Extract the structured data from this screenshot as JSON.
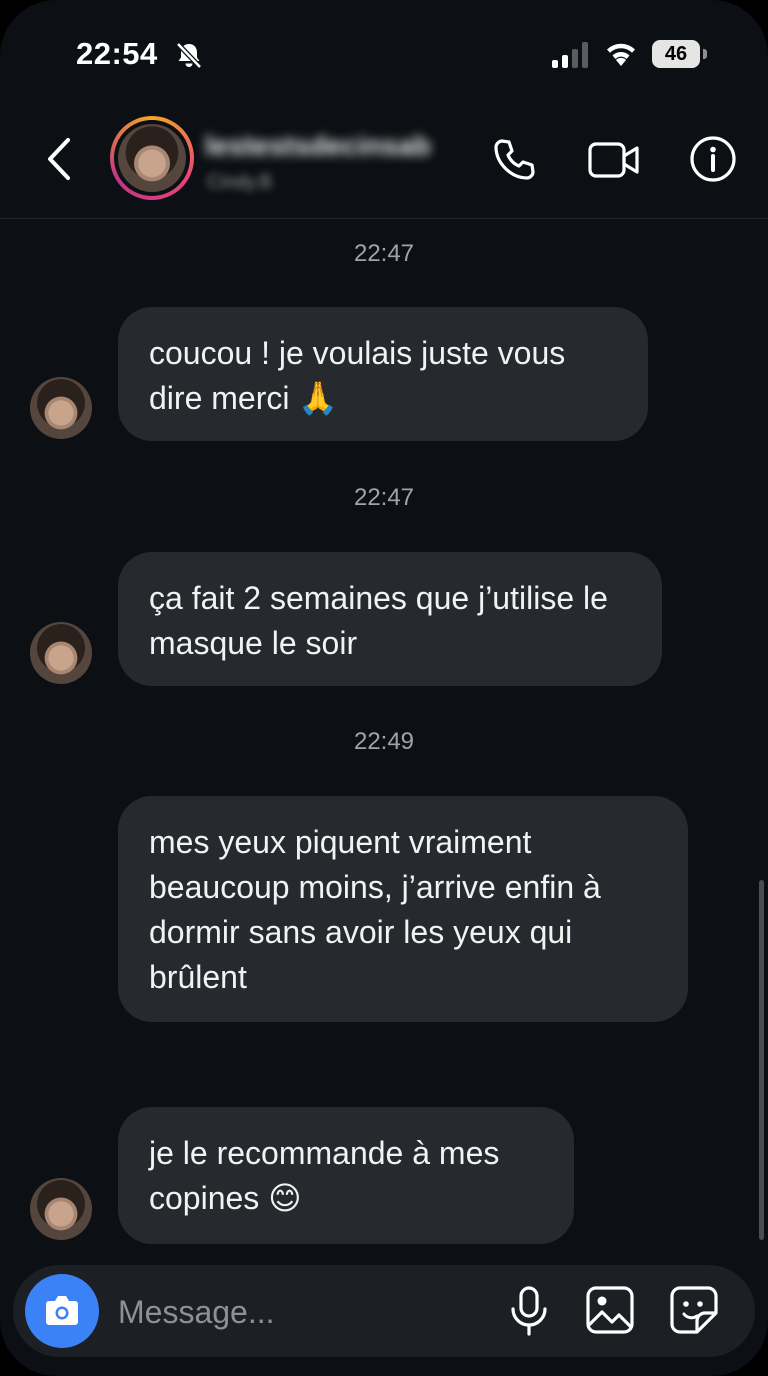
{
  "status_bar": {
    "time": "22:54",
    "battery": "46"
  },
  "header": {
    "username": "lestestsdecinsab",
    "subtitle": "Cindy.B"
  },
  "messages": [
    {
      "timestamp": "22:47",
      "text": "coucou ! je voulais juste vous dire merci 🙏",
      "show_avatar": true
    },
    {
      "timestamp": "22:47",
      "text": "ça fait 2 semaines que j’utilise le masque le soir",
      "show_avatar": true
    },
    {
      "timestamp": "22:49",
      "text": "mes yeux piquent vraiment beaucoup moins, j’arrive enfin à dormir sans avoir les yeux qui brûlent",
      "show_avatar": false
    },
    {
      "timestamp": "",
      "text": "je le recommande à mes copines 😊",
      "show_avatar": true
    }
  ],
  "composer": {
    "placeholder": "Message..."
  },
  "colors": {
    "background": "#0c1014",
    "bubble": "#262a2f",
    "camera_button": "#3b82f6"
  },
  "icons": [
    "bell-off-icon",
    "signal-icon",
    "wifi-icon",
    "back-icon",
    "phone-icon",
    "video-icon",
    "info-icon",
    "camera-icon",
    "microphone-icon",
    "gallery-icon",
    "sticker-icon"
  ]
}
